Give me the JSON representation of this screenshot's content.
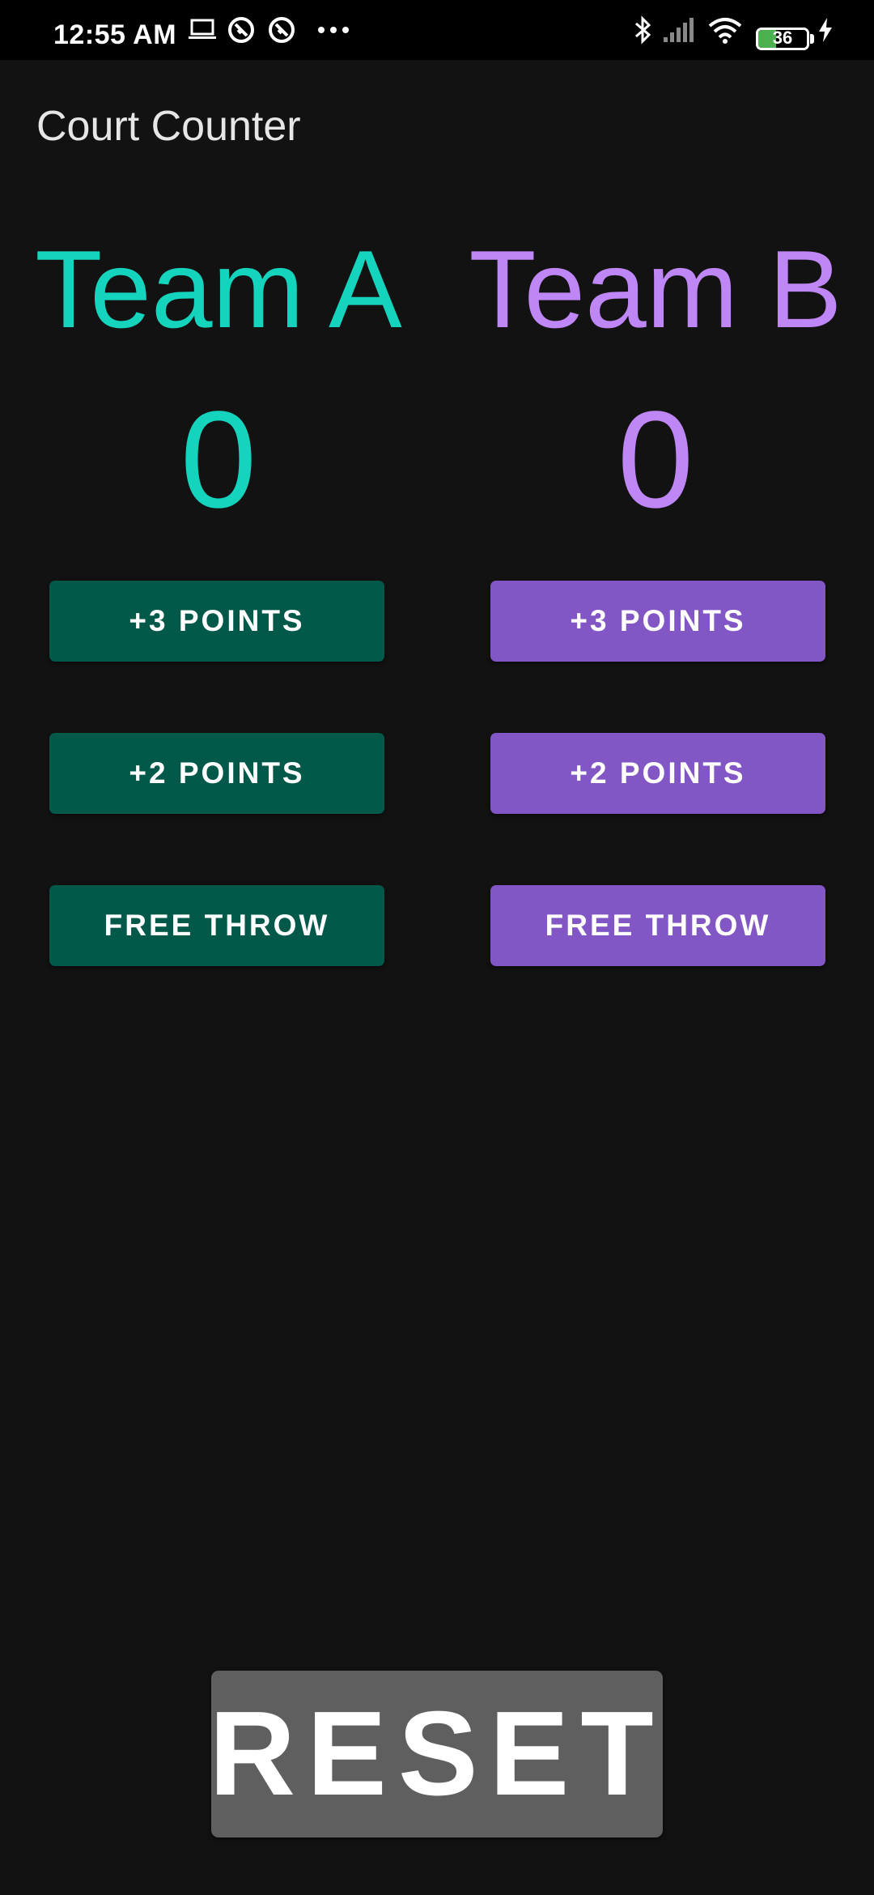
{
  "status_bar": {
    "time": "12:55 AM",
    "left_icons": [
      "laptop-icon",
      "sync-icon",
      "sync-icon",
      "more-icon"
    ],
    "right_icons": [
      "bluetooth-icon",
      "signal-icon",
      "wifi-icon",
      "battery-icon",
      "charging-icon"
    ],
    "battery_level": "36"
  },
  "app_bar": {
    "title": "Court Counter"
  },
  "teams": [
    {
      "name": "Team A",
      "score": "0",
      "color": "#14d4be",
      "button_color": "#02594a",
      "buttons": [
        "+3 POINTS",
        "+2 POINTS",
        "FREE THROW"
      ]
    },
    {
      "name": "Team B",
      "score": "0",
      "color": "#bf86f5",
      "button_color": "#8356c6",
      "buttons": [
        "+3 POINTS",
        "+2 POINTS",
        "FREE THROW"
      ]
    }
  ],
  "reset": {
    "label": "RESET"
  }
}
